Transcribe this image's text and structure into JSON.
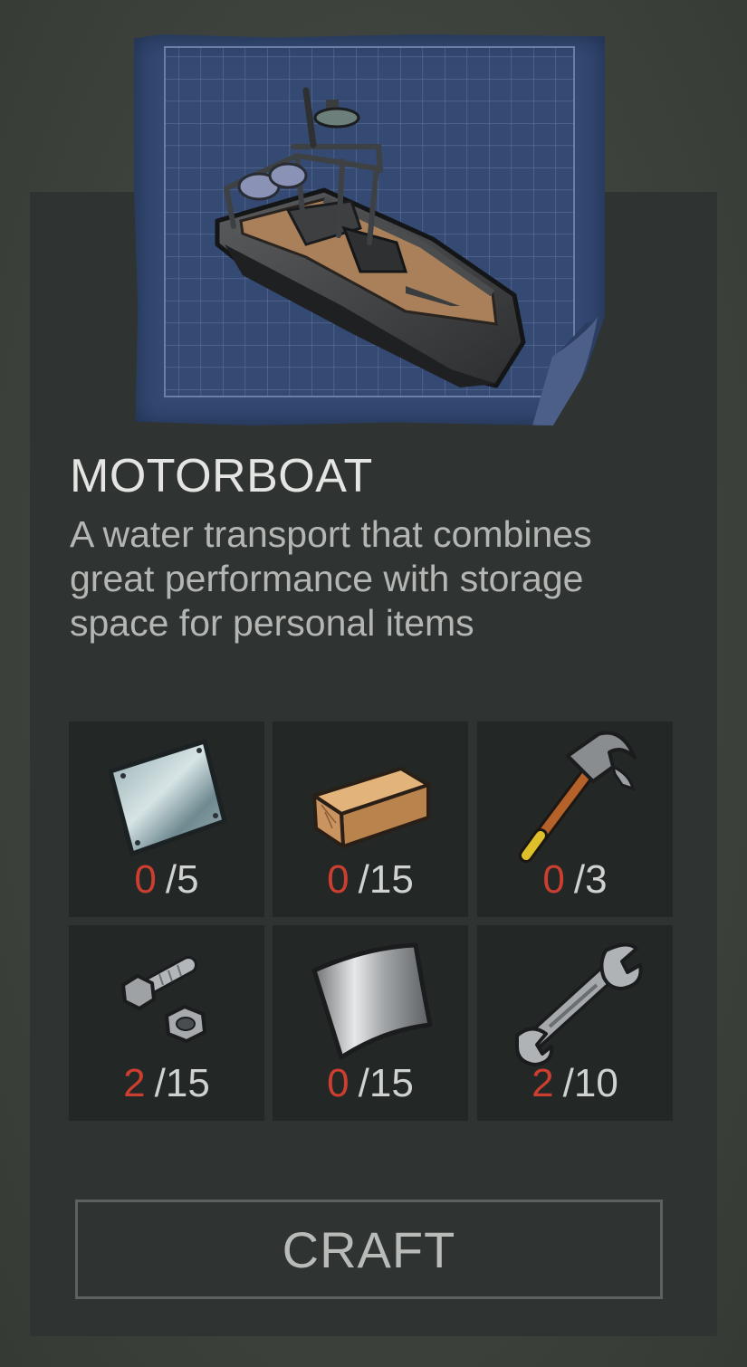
{
  "item": {
    "image_icon": "motorboat-blueprint",
    "title": "MOTORBOAT",
    "description": "A water transport that combines great performance with storage space for personal items"
  },
  "requirements": [
    {
      "icon": "metal-plate-icon",
      "have": "0",
      "need": "/5"
    },
    {
      "icon": "wooden-plank-icon",
      "have": "0",
      "need": "/15"
    },
    {
      "icon": "hammer-icon",
      "have": "0",
      "need": "/3"
    },
    {
      "icon": "bolt-and-nut-icon",
      "have": "2",
      "need": "/15"
    },
    {
      "icon": "sheet-metal-icon",
      "have": "0",
      "need": "/15"
    },
    {
      "icon": "wrench-icon",
      "have": "2",
      "need": "/10"
    }
  ],
  "actions": {
    "craft_label": "CRAFT"
  },
  "colors": {
    "background": "#3f433d",
    "panel": "#2f3331",
    "cell": "#232725",
    "blueprint": "#344a73",
    "have_count": "#cc3e30",
    "need_count": "#cfd2ce",
    "title": "#e4e4e2",
    "description": "#b3b6b2"
  }
}
